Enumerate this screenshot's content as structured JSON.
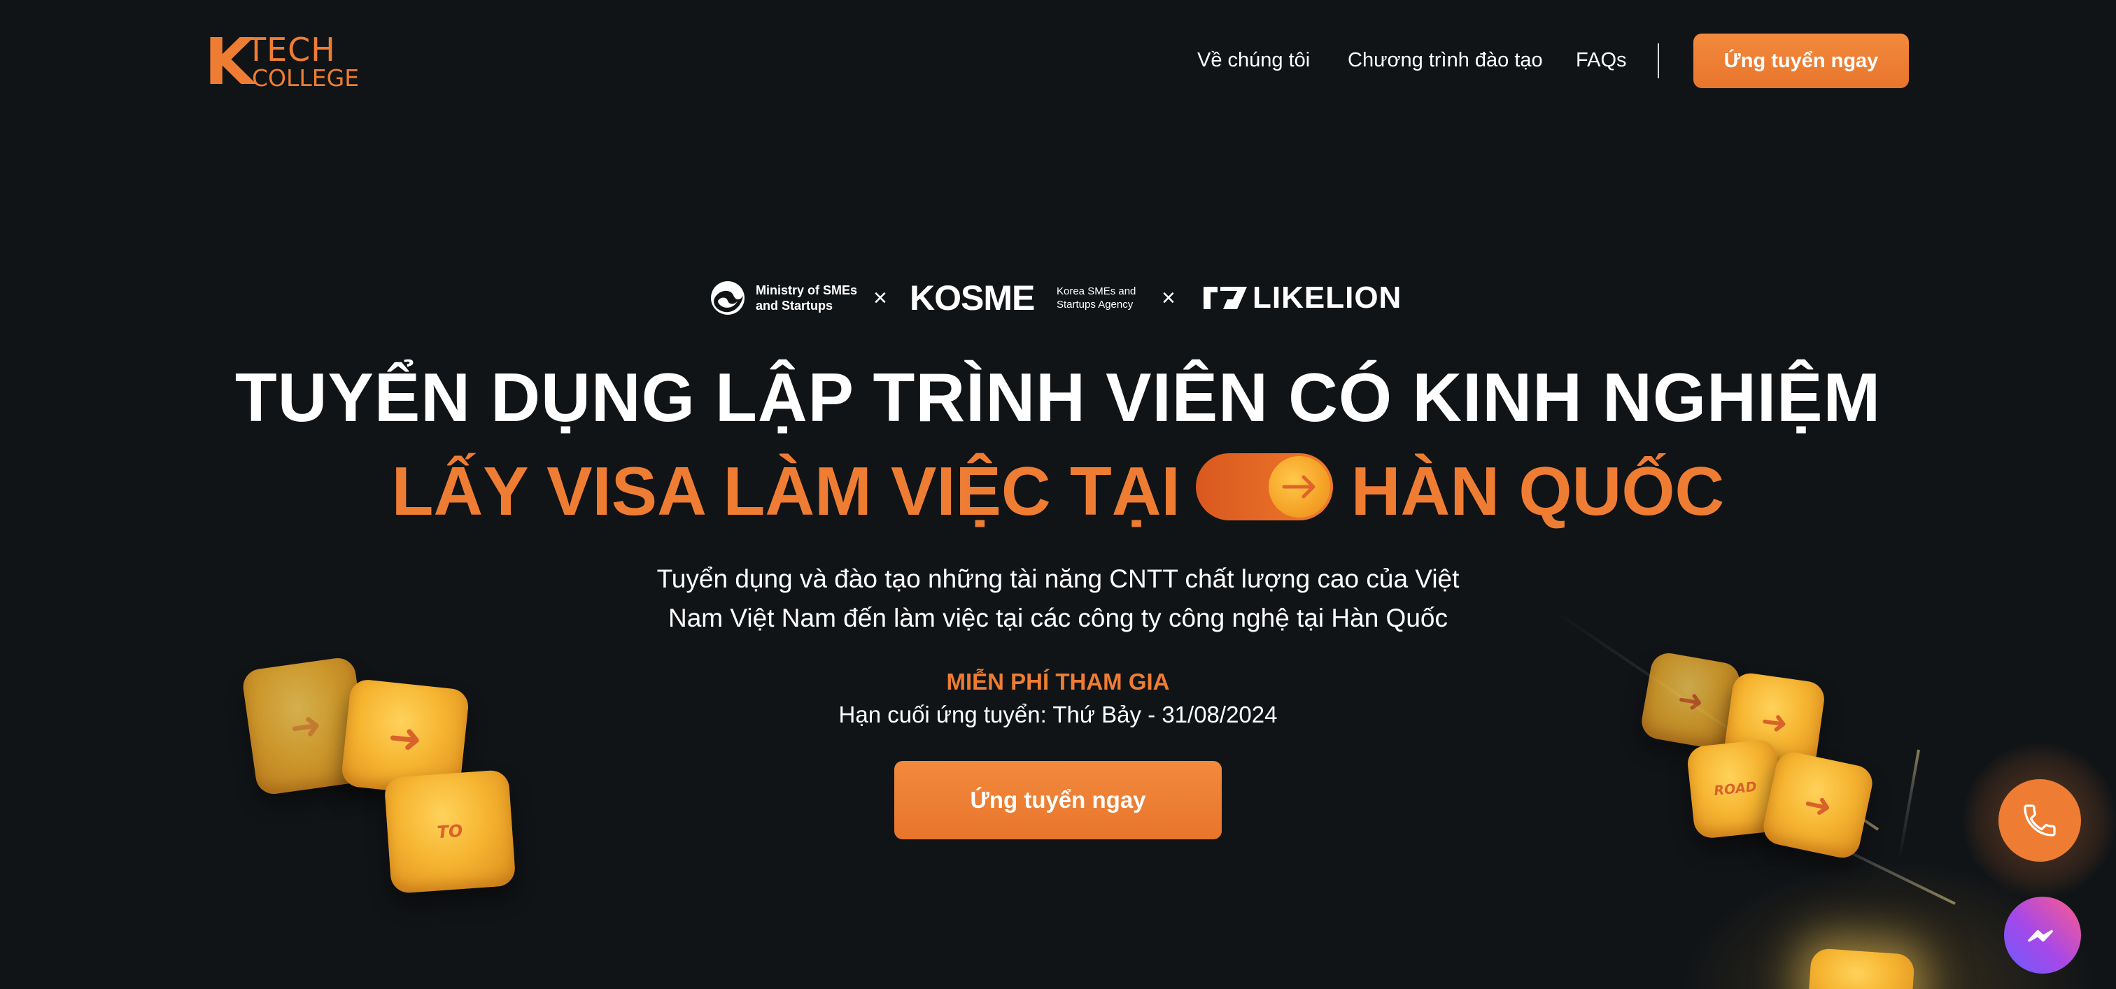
{
  "header": {
    "logo": {
      "k": "K",
      "tech": "TECH",
      "college": "COLLEGE"
    },
    "nav": [
      {
        "label": "Về chúng tôi"
      },
      {
        "label": "Chương trình đào tạo"
      },
      {
        "label": "FAQs"
      }
    ],
    "apply_label": "Ứng tuyển ngay"
  },
  "partners": {
    "ministry": "Ministry of SMEs\nand Startups",
    "separator": "×",
    "kosme": "KOSME",
    "kosme_sub": "Korea SMEs and\nStartups Agency",
    "likelion": "LIKELION"
  },
  "hero": {
    "headline_line1": "TUYỂN DỤNG LẬP TRÌNH VIÊN CÓ KINH NGHIỆM",
    "headline_line2_a": "LẤY VISA LÀM VIỆC TẠI",
    "headline_line2_b": "HÀN QUỐC",
    "description_line1": "Tuyển dụng và đào tạo những tài năng CNTT chất lượng cao của Việt",
    "description_line2": "Nam Việt Nam đến làm việc tại các công ty công nghệ tại Hàn Quốc",
    "free_label": "MIỄN PHÍ THAM GIA",
    "deadline": "Hạn cuối ứng tuyển: Thứ Bảy - 31/08/2024",
    "apply_label": "Ứng tuyển ngay"
  },
  "decor": {
    "key_to": "TO",
    "key_road": "ROAD"
  },
  "colors": {
    "background": "#111417",
    "accent": "#ee7d33",
    "text": "#ffffff"
  },
  "icons": {
    "phone": "phone-icon",
    "messenger": "messenger-icon",
    "arrow": "arrow-right-icon"
  }
}
